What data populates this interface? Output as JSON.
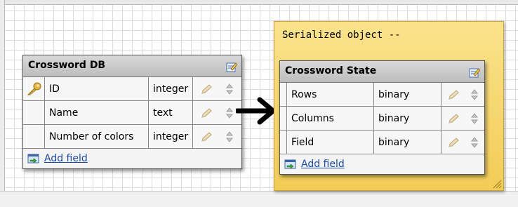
{
  "tables": [
    {
      "title": "Crossword DB",
      "fields": [
        {
          "name": "ID",
          "type": "integer",
          "is_key": true
        },
        {
          "name": "Name",
          "type": "text",
          "is_key": false
        },
        {
          "name": "Number of colors",
          "type": "integer",
          "is_key": false
        }
      ],
      "add_label": "Add field"
    },
    {
      "title": "Crossword State",
      "fields": [
        {
          "name": "Rows",
          "type": "binary"
        },
        {
          "name": "Columns",
          "type": "binary"
        },
        {
          "name": "Field",
          "type": "binary"
        }
      ],
      "add_label": "Add field"
    }
  ],
  "note": {
    "text": "Serialized object --"
  },
  "icons": [
    "key-icon",
    "pencil-icon",
    "sort-arrows-icon",
    "edit-table-icon",
    "add-field-icon",
    "arrow-icon"
  ],
  "colors": {
    "note_bg": "#f6d46b",
    "header_bg": "#c8c8c8",
    "link": "#1a4aa8"
  }
}
